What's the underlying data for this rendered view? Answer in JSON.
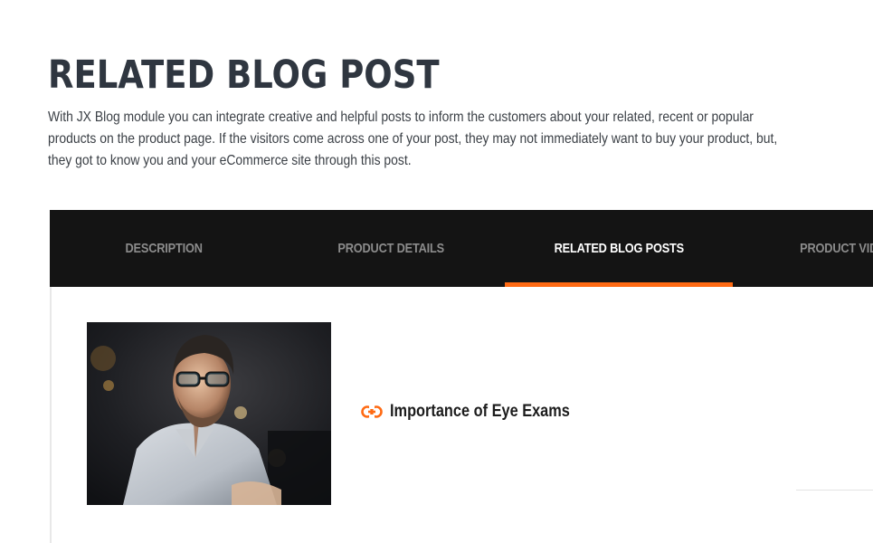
{
  "section": {
    "title": "RELATED BLOG POST",
    "description": "With JX Blog module you can integrate creative and helpful posts to inform the customers about your related, recent or popular products on the product page. If the visitors come across one of your post, they may not immediately want to buy your product, but, they got to know you and your eCommerce site through this post."
  },
  "tabs": [
    {
      "label": "DESCRIPTION",
      "active": false
    },
    {
      "label": "PRODUCT DETAILS",
      "active": false
    },
    {
      "label": "RELATED BLOG POSTS",
      "active": true
    },
    {
      "label": "PRODUCT VIDEO",
      "active": false
    }
  ],
  "post": {
    "title": "Importance of Eye Exams",
    "icon": "link-icon"
  },
  "colors": {
    "tab_bar": "#141414",
    "accent": "#ff6a13",
    "title": "#2f3640"
  }
}
